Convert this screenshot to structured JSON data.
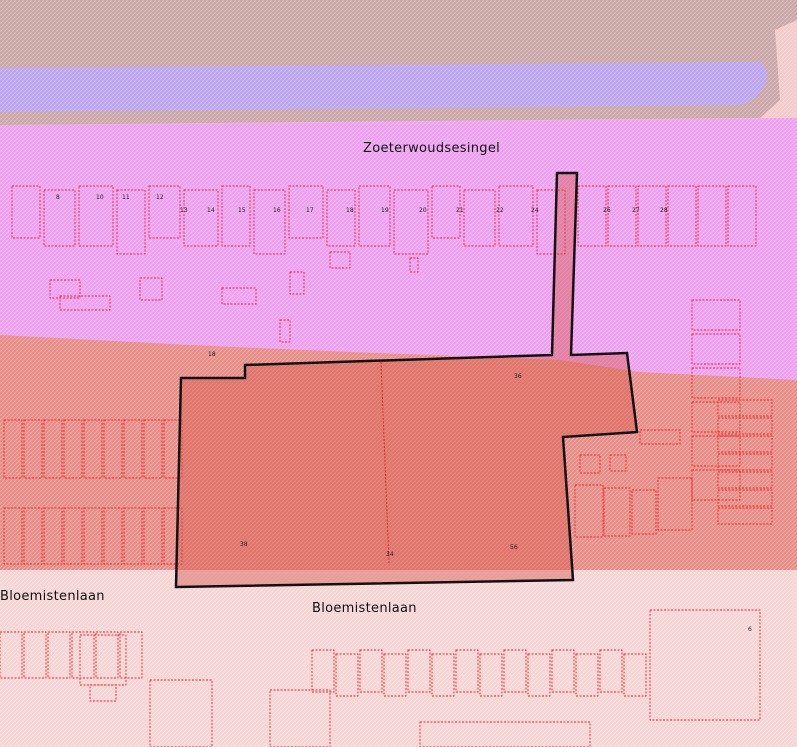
{
  "streets": {
    "north": "Zoeterwoudsesingel",
    "south_left": "Bloemistenlaan",
    "south_center": "Bloemistenlaan"
  },
  "colors": {
    "canal": "#b9a2ee",
    "canal_bank": "#c9a5a5",
    "residential_pink": "#ee9ef0",
    "mixed_red": "#e88a84",
    "street_pale": "#f6d4d4",
    "parcel_outline": "#e8262b",
    "plan_boundary": "#111111"
  },
  "house_numbers": {
    "north_row": [
      "8",
      "10",
      "11",
      "12",
      "13",
      "14",
      "15",
      "16",
      "17",
      "18",
      "19",
      "20",
      "21",
      "22",
      "24",
      "26",
      "27",
      "28"
    ],
    "plan_area": [
      "38",
      "34",
      "36",
      "56"
    ],
    "misc": [
      "18",
      "6"
    ]
  }
}
